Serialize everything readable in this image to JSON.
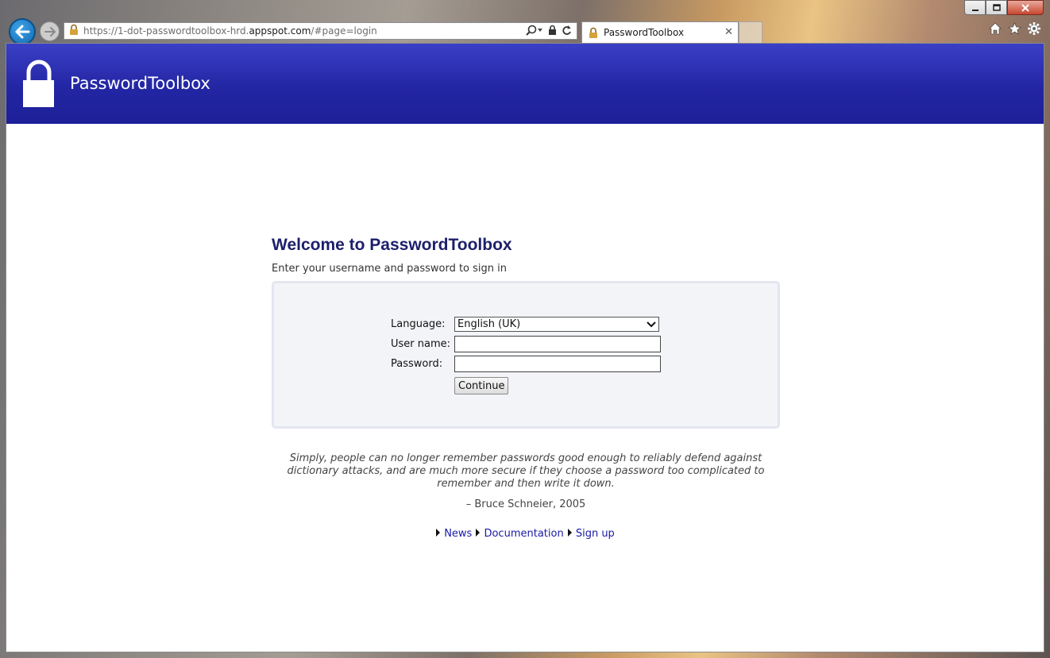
{
  "browser": {
    "url_prefix": "https://1-dot-passwordtoolbox-hrd.",
    "url_host": "appspot.com",
    "url_suffix": "/#page=login",
    "tab_title": "PasswordToolbox",
    "icons": [
      "back-arrow-icon",
      "forward-arrow-icon",
      "lock-icon",
      "search-icon",
      "refresh-icon",
      "home-icon",
      "star-icon",
      "gear-icon"
    ]
  },
  "header": {
    "title": "PasswordToolbox",
    "logo_icon": "padlock-icon"
  },
  "login": {
    "heading": "Welcome to PasswordToolbox",
    "subheading": "Enter your username and password to sign in",
    "language_label": "Language:",
    "language_value": "English (UK)",
    "username_label": "User name:",
    "username_value": "",
    "password_label": "Password:",
    "password_value": "",
    "continue_label": "Continue"
  },
  "quote": {
    "text": "Simply, people can no longer remember passwords good enough to reliably defend against dictionary attacks, and are much more secure if they choose a password too complicated to remember and then write it down.",
    "author": "– Bruce Schneier, 2005"
  },
  "footer_links": [
    {
      "label": "News"
    },
    {
      "label": "Documentation"
    },
    {
      "label": "Sign up"
    }
  ],
  "colors": {
    "header_bg": "#2326a3",
    "heading": "#1c1f6b",
    "link": "#1a1aa6",
    "login_box_bg": "#f3f4f8"
  }
}
